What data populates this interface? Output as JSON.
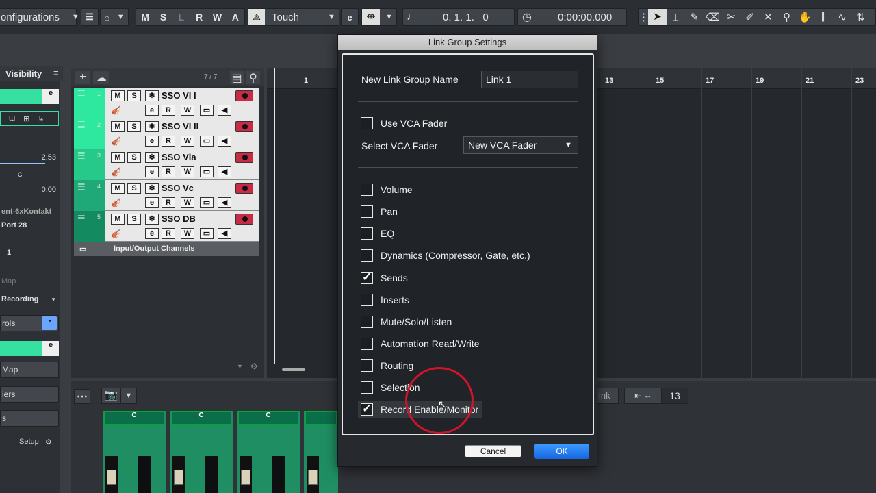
{
  "toolbar": {
    "configurations_label": "onfigurations",
    "msrw": [
      "M",
      "S",
      "L",
      "R",
      "W",
      "A"
    ],
    "automation_mode": "Touch",
    "position": "0. 1. 1.   0",
    "time": "0:00:00.000"
  },
  "inspector": {
    "header": "Visibility",
    "value_1": "2.53",
    "value_2": "0.00",
    "pan_label": "C",
    "instrument": "ent-6xKontakt",
    "port": "Port 28",
    "channel": "1",
    "map": "Map",
    "recording": "Recording",
    "controls": "rols",
    "map_btn": "Map",
    "modifiers": "iers",
    "inserts": "s",
    "setup": "Setup"
  },
  "tracklist": {
    "count": "7 / 7",
    "tracks": [
      {
        "num": "1",
        "name": "SSO Vl I"
      },
      {
        "num": "2",
        "name": "SSO Vl II"
      },
      {
        "num": "3",
        "name": "SSO Vla"
      },
      {
        "num": "4",
        "name": "SSO Vc"
      },
      {
        "num": "5",
        "name": "SSO DB"
      }
    ],
    "io_channels": "Input/Output Channels",
    "btn_m": "M",
    "btn_s": "S",
    "btn_e": "e",
    "btn_r": "R",
    "btn_w": "W"
  },
  "ruler": {
    "labels": [
      "1",
      "13",
      "15",
      "17",
      "19",
      "21",
      "23"
    ]
  },
  "mixer": {
    "strip_label": "C",
    "link_label": "ink",
    "zoom_value": "13"
  },
  "dialog": {
    "title": "Link Group Settings",
    "name_label": "New Link Group Name",
    "name_value": "Link 1",
    "use_vca_label": "Use VCA Fader",
    "use_vca_checked": false,
    "select_vca_label": "Select VCA Fader",
    "select_vca_value": "New VCA Fader",
    "options": [
      {
        "label": "Volume",
        "checked": false
      },
      {
        "label": "Pan",
        "checked": false
      },
      {
        "label": "EQ",
        "checked": false
      },
      {
        "label": "Dynamics (Compressor, Gate, etc.)",
        "checked": false
      },
      {
        "label": "Sends",
        "checked": true
      },
      {
        "label": "Inserts",
        "checked": false
      },
      {
        "label": "Mute/Solo/Listen",
        "checked": false
      },
      {
        "label": "Automation Read/Write",
        "checked": false
      },
      {
        "label": "Routing",
        "checked": false
      },
      {
        "label": "Selection",
        "checked": false
      },
      {
        "label": "Record Enable/Monitor",
        "checked": true
      }
    ],
    "cancel_label": "Cancel",
    "ok_label": "OK"
  }
}
